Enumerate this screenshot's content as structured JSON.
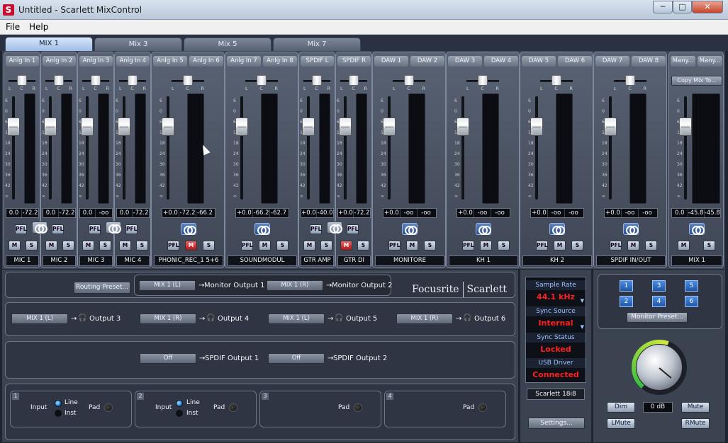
{
  "window": {
    "app_icon": "S",
    "title": "Untitled - Scarlett MixControl",
    "min": "─",
    "max": "□",
    "close": "✕"
  },
  "menu": [
    "File",
    "Help"
  ],
  "tabs": [
    "MIX 1",
    "Mix 3",
    "Mix 5",
    "Mix 7"
  ],
  "pan_scale": [
    "L",
    "C",
    "R"
  ],
  "fader_scale": [
    "6",
    "0",
    "6",
    "12",
    "18",
    "24",
    "30",
    "36",
    "42",
    "∞"
  ],
  "groups": [
    {
      "name": "MIC 1",
      "type": "mono",
      "input": "Anlg In 1",
      "gain": "0.0",
      "level": "-72.2",
      "fader": 0.28,
      "buttons": [
        "PFL",
        "M",
        "S"
      ]
    },
    {
      "name": "MIC 2",
      "type": "mono",
      "input": "Anlg In 2",
      "gain": "0.0",
      "level": "-72.2",
      "fader": 0.28,
      "buttons": [
        "PFL",
        "M",
        "S"
      ],
      "link_before": true
    },
    {
      "name": "MIC 3",
      "type": "mono",
      "input": "Anlg In 3",
      "gain": "0.0",
      "level": "-oo",
      "fader": 0.28,
      "buttons": [
        "PFL",
        "M",
        "S"
      ]
    },
    {
      "name": "MIC 4",
      "type": "mono",
      "input": "Anlg In 4",
      "gain": "0.0",
      "level": "-72.2",
      "fader": 0.28,
      "buttons": [
        "PFL",
        "M",
        "S"
      ],
      "link_before": true
    },
    {
      "name": "PHONIC_REC_1 5+6",
      "type": "stereo",
      "inputs": [
        "Anlg In 5",
        "Anlg In 6"
      ],
      "gain": "+0.0",
      "l": "-72.2",
      "r": "-66.2",
      "fader": 0.28,
      "buttons": [
        "PFL",
        "M",
        "S"
      ],
      "mute_on": true
    },
    {
      "name": "SOUNDMODUL",
      "type": "stereo",
      "inputs": [
        "Anlg In 7",
        "Anlg In 8"
      ],
      "gain": "+0.0",
      "l": "-66.2",
      "r": "-62.7",
      "fader": 0.28,
      "buttons": [
        "PFL",
        "M",
        "S"
      ]
    },
    {
      "name": "GTR AMP",
      "type": "mono",
      "input": "SPDIF L",
      "gain": "+0.0",
      "level": "-40.0",
      "fader": 0.28,
      "buttons": [
        "PFL",
        "M",
        "S"
      ]
    },
    {
      "name": "GTR DI",
      "type": "mono",
      "input": "SPDIF R",
      "gain": "+0.0",
      "level": "-72.2",
      "fader": 0.28,
      "buttons": [
        "PFL",
        "M",
        "S"
      ],
      "link_before": true,
      "mute_on": true
    },
    {
      "name": "MONITORE",
      "type": "stereo",
      "inputs": [
        "DAW 1",
        "DAW 2"
      ],
      "gain": "+0.0",
      "l": "-oo",
      "r": "-oo",
      "fader": 0.28,
      "buttons": [
        "PFL",
        "M",
        "S"
      ]
    },
    {
      "name": "KH 1",
      "type": "stereo",
      "inputs": [
        "DAW 3",
        "DAW 4"
      ],
      "gain": "+0.0",
      "l": "-oo",
      "r": "-oo",
      "fader": 0.28,
      "buttons": [
        "PFL",
        "M",
        "S"
      ]
    },
    {
      "name": "KH 2",
      "type": "stereo",
      "inputs": [
        "DAW 5",
        "DAW 6"
      ],
      "gain": "+0.0",
      "l": "-oo",
      "r": "-oo",
      "fader": 0.28,
      "buttons": [
        "PFL",
        "M",
        "S"
      ]
    },
    {
      "name": "SPDIF IN/OUT",
      "type": "stereo",
      "inputs": [
        "DAW 7",
        "DAW 8"
      ],
      "gain": "+0.0",
      "l": "-oo",
      "r": "-oo",
      "fader": 0.28,
      "buttons": [
        "PFL",
        "M",
        "S"
      ]
    },
    {
      "name": "MIX 1",
      "type": "master",
      "inputs": [
        "Many...",
        "Many..."
      ],
      "copy": "Copy Mix To...",
      "gain": "0.0",
      "l": "-45.8",
      "r": "-45.8",
      "fader": 0.28,
      "buttons": [
        "M",
        "S"
      ]
    }
  ],
  "routing": {
    "preset": "Routing Preset...",
    "rows": [
      [
        {
          "src": "MIX 1 (L)",
          "dst": "Monitor Output 1"
        },
        {
          "src": "MIX 1 (R)",
          "dst": "Monitor Output 2"
        }
      ],
      [
        {
          "src": "MIX 1 (L)",
          "dst": "Output 3"
        },
        {
          "src": "MIX 1 (R)",
          "dst": "Output 4"
        },
        {
          "src": "MIX 1 (L)",
          "dst": "Output 5"
        },
        {
          "src": "MIX 1 (R)",
          "dst": "Output 6"
        }
      ],
      [
        {
          "src": "Off",
          "dst": "SPDIF Output 1"
        },
        {
          "src": "Off",
          "dst": "SPDIF Output 2"
        }
      ]
    ],
    "arrow": "→",
    "headphone": "🎧"
  },
  "brand": {
    "left": "Focusrite",
    "right": "Scarlett"
  },
  "inputs": [
    {
      "num": "1",
      "input": "Input",
      "line": "Line",
      "inst": "Inst",
      "pad": "Pad"
    },
    {
      "num": "2",
      "input": "Input",
      "line": "Line",
      "inst": "Inst",
      "pad": "Pad"
    },
    {
      "num": "3",
      "pad": "Pad"
    },
    {
      "num": "4",
      "pad": "Pad"
    }
  ],
  "status": {
    "sample_rate_label": "Sample Rate",
    "sample_rate": "44.1 kHz",
    "sync_source_label": "Sync Source",
    "sync_source": "Internal",
    "sync_status_label": "Sync Status",
    "sync_status": "Locked",
    "usb_label": "USB  Driver",
    "usb": "Connected",
    "model": "Scarlett 18i8",
    "settings": "Settings..."
  },
  "monitor": {
    "buttons": [
      "1",
      "3",
      "5",
      "2",
      "4",
      "6"
    ],
    "preset": "Monitor Preset...",
    "dim": "Dim",
    "db": "0 dB",
    "mute": "Mute",
    "lmute": "LMute",
    "rmute": "RMute"
  },
  "colors": {
    "accent": "#2f6fd6",
    "status_red": "#ff2020",
    "meter_green": "#2fbf3f"
  }
}
